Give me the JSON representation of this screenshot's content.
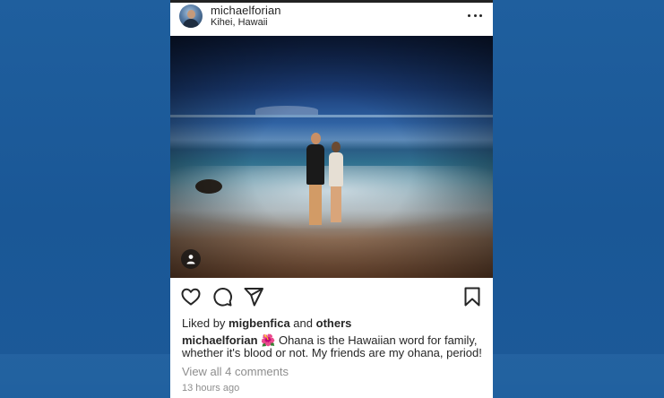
{
  "post": {
    "username": "michaelforian",
    "location": "Kihei, Hawaii",
    "more_icon": "more-horizontal-icon",
    "photo_alt": "",
    "tag_icon": "user-tag-icon"
  },
  "actions": {
    "like_icon": "heart-icon",
    "comment_icon": "comment-icon",
    "share_icon": "send-icon",
    "save_icon": "bookmark-icon"
  },
  "likes": {
    "prefix": "Liked by",
    "user": "migbenfica",
    "joiner": "and",
    "others": "others"
  },
  "caption": {
    "username": "michaelforian",
    "emoji": "🌺",
    "text": "Ohana is the Hawaiian word for family, whether it's blood or not. My friends are my ohana, period!"
  },
  "comments": {
    "view_all": "View all 4 comments"
  },
  "timestamp": "13 hours ago",
  "colors": {
    "background": "#1a5796",
    "text": "#262626",
    "muted": "#8e8e8e",
    "hibiscus": "#e8323c"
  }
}
